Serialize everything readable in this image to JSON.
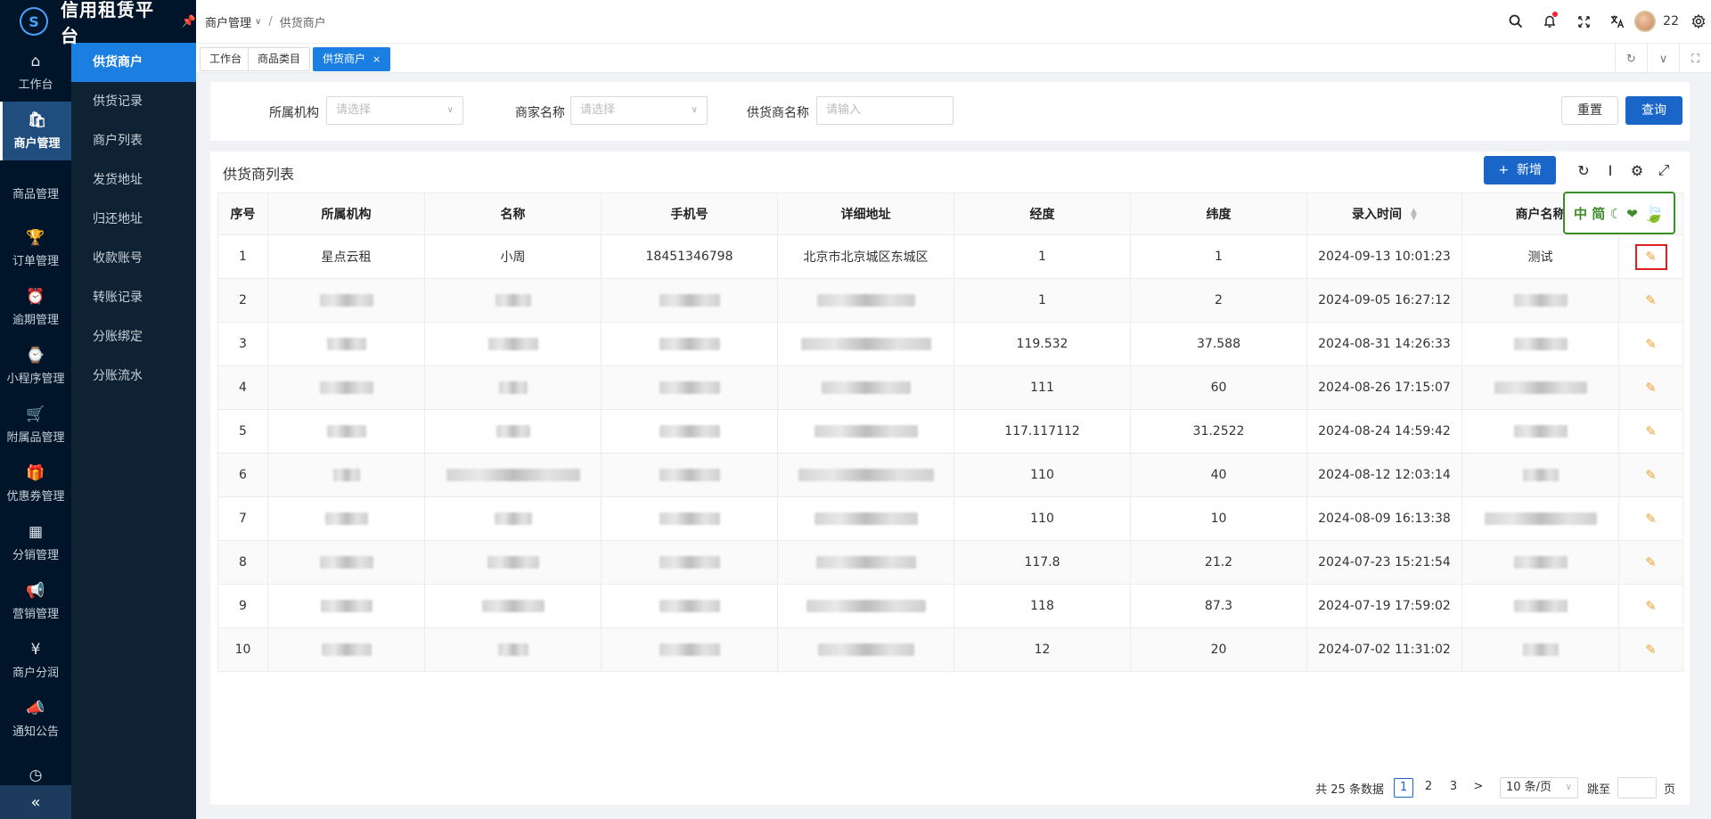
{
  "brand": {
    "name": "信用租赁平台",
    "logo_icon": "logo-icon",
    "pin_icon": "pin-icon"
  },
  "rail": [
    {
      "label": "工作台",
      "icon": "home-icon",
      "glyph": "⌂",
      "active": false
    },
    {
      "label": "商户管理",
      "icon": "bag-icon",
      "glyph": "🛍",
      "active": true
    },
    {
      "label": "商品管理",
      "icon": "apple-icon",
      "glyph": "",
      "active": false
    },
    {
      "label": "订单管理",
      "icon": "trophy-icon",
      "glyph": "🏆",
      "active": false
    },
    {
      "label": "逾期管理",
      "icon": "alarm-icon",
      "glyph": "⏰",
      "active": false
    },
    {
      "label": "小程序管理",
      "icon": "watch-icon",
      "glyph": "⌚",
      "active": false
    },
    {
      "label": "附属品管理",
      "icon": "cart-icon",
      "glyph": "🛒",
      "active": false
    },
    {
      "label": "优惠券管理",
      "icon": "gift-icon",
      "glyph": "🎁",
      "active": false
    },
    {
      "label": "分销管理",
      "icon": "chart-icon",
      "glyph": "▦",
      "active": false
    },
    {
      "label": "营销管理",
      "icon": "megaphone-icon",
      "glyph": "📢",
      "active": false
    },
    {
      "label": "商户分润",
      "icon": "yen-icon",
      "glyph": "¥",
      "active": false
    },
    {
      "label": "通知公告",
      "icon": "notice-icon",
      "glyph": "📣",
      "active": false
    },
    {
      "label": "",
      "icon": "clock-icon",
      "glyph": "◷",
      "active": false
    }
  ],
  "submenu": [
    {
      "label": "供货商户",
      "active": true
    },
    {
      "label": "供货记录",
      "active": false
    },
    {
      "label": "商户列表",
      "active": false
    },
    {
      "label": "发货地址",
      "active": false
    },
    {
      "label": "归还地址",
      "active": false
    },
    {
      "label": "收款账号",
      "active": false
    },
    {
      "label": "转账记录",
      "active": false
    },
    {
      "label": "分账绑定",
      "active": false
    },
    {
      "label": "分账流水",
      "active": false
    }
  ],
  "header": {
    "breadcrumb_parent": "商户管理",
    "breadcrumb_sep": "/",
    "breadcrumb_current": "供货商户",
    "user_name": "22"
  },
  "tabs": [
    {
      "label": "工作台",
      "active": false,
      "closable": false
    },
    {
      "label": "商品类目",
      "active": false,
      "closable": false
    },
    {
      "label": "供货商户",
      "active": true,
      "closable": true
    }
  ],
  "filter": {
    "org_label": "所属机构",
    "org_placeholder": "请选择",
    "merchant_label": "商家名称",
    "merchant_placeholder": "请选择",
    "supplier_label": "供货商名称",
    "supplier_placeholder": "请输入",
    "reset_label": "重置",
    "search_label": "查询"
  },
  "list": {
    "title": "供货商列表",
    "add_label": "新增",
    "add_plus": "+",
    "columns": [
      "序号",
      "所属机构",
      "名称",
      "手机号",
      "详细地址",
      "经度",
      "纬度",
      "录入时间",
      "商户名称",
      ""
    ],
    "rows": [
      {
        "no": "1",
        "org": "星点云租",
        "name": "小周",
        "phone": "18451346798",
        "addr": "北京市北京城区东城区",
        "lng": "1",
        "lat": "1",
        "time": "2024-09-13 10:01:23",
        "merchant": "测试",
        "hl": true
      },
      {
        "no": "2",
        "lng": "1",
        "lat": "2",
        "time": "2024-09-05 16:27:12"
      },
      {
        "no": "3",
        "lng": "119.532",
        "lat": "37.588",
        "time": "2024-08-31 14:26:33"
      },
      {
        "no": "4",
        "lng": "111",
        "lat": "60",
        "time": "2024-08-26 17:15:07"
      },
      {
        "no": "5",
        "lng": "117.117112",
        "lat": "31.2522",
        "time": "2024-08-24 14:59:42"
      },
      {
        "no": "6",
        "lng": "110",
        "lat": "40",
        "time": "2024-08-12 12:03:14"
      },
      {
        "no": "7",
        "lng": "110",
        "lat": "10",
        "time": "2024-08-09 16:13:38"
      },
      {
        "no": "8",
        "lng": "117.8",
        "lat": "21.2",
        "time": "2024-07-23 15:21:54"
      },
      {
        "no": "9",
        "lng": "118",
        "lat": "87.3",
        "time": "2024-07-19 17:59:02"
      },
      {
        "no": "10",
        "lng": "12",
        "lat": "20",
        "time": "2024-07-02 11:31:02"
      }
    ]
  },
  "ime": {
    "text": "中 简 ☾ ❤",
    "icon": "leaf-icon"
  },
  "pager": {
    "total_text": "共 25 条数据",
    "pages": [
      "1",
      "2",
      "3"
    ],
    "current": "1",
    "next": ">",
    "page_size": "10 条/页",
    "jump_label": "跳至",
    "page_suffix": "页"
  },
  "colors": {
    "primary": "#1a65c8",
    "sidebar": "#001529",
    "active_menu": "#1a7fe0",
    "edit": "#f0a030",
    "highlight": "#e02020"
  }
}
